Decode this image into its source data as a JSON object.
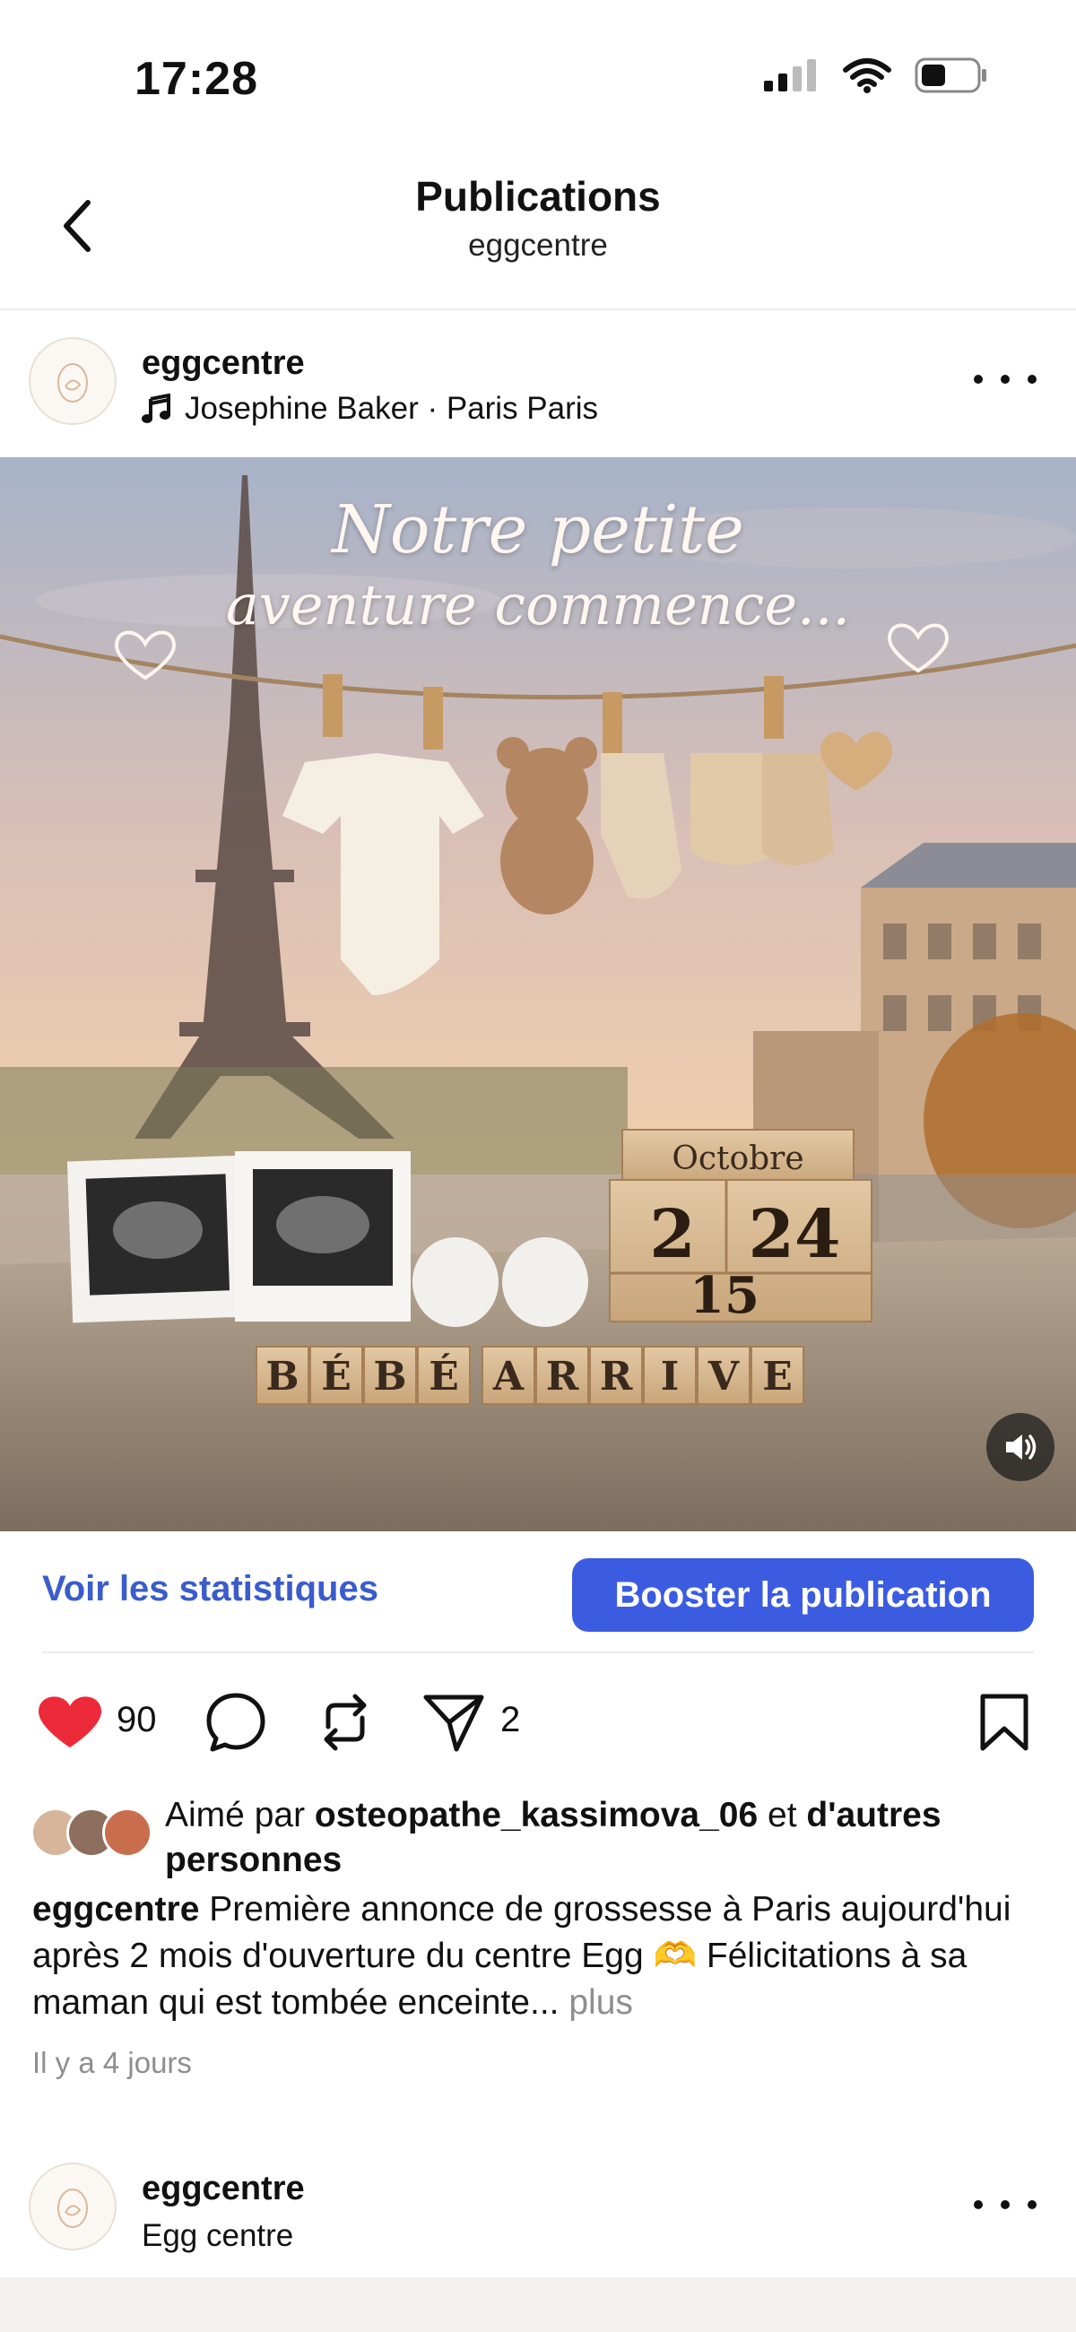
{
  "status_bar": {
    "time": "17:28"
  },
  "nav": {
    "title": "Publications",
    "subtitle": "eggcentre"
  },
  "post": {
    "username": "eggcentre",
    "music": "Josephine Baker · Paris Paris",
    "image": {
      "overlay_line1": "Notre petite",
      "overlay_line2": "aventure commence...",
      "block_month": "Octobre",
      "block_d1": "2",
      "block_d2": "24",
      "block_year": "15",
      "letters_word1": [
        "B",
        "É",
        "B",
        "É"
      ],
      "letters_word2": [
        "A",
        "R",
        "R",
        "I",
        "V",
        "E"
      ]
    },
    "stats_label": "Voir les statistiques",
    "boost_label": "Booster la publication",
    "like_count": "90",
    "share_count": "2",
    "liked_by_prefix": "Aimé par",
    "liked_by_user": "osteopathe_kassimova_06",
    "liked_by_and": "et",
    "liked_by_others": "d'autres personnes",
    "caption_user": "eggcentre",
    "caption_text": "Première annonce de grossesse à Paris aujourd'hui après 2 mois d'ouverture du centre Egg 🫶 Félicitations à sa maman qui est tombée enceinte...",
    "caption_more": "plus",
    "time_ago": "Il y a 4 jours"
  },
  "next_post": {
    "username": "eggcentre",
    "subtitle": "Egg centre"
  },
  "colors": {
    "accent": "#3b5ce0",
    "link": "#3a5ccc",
    "like": "#ed2a3a",
    "muted": "#8e8e8e"
  }
}
